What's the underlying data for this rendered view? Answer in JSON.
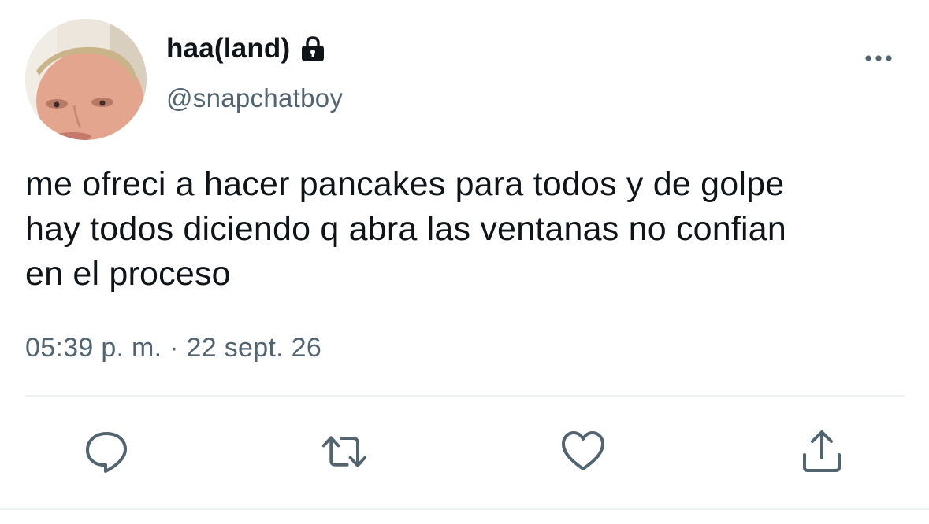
{
  "tweet": {
    "display_name": "haa(land)",
    "handle": "@snapchatboy",
    "text": "me ofreci a hacer pancakes para todos y de golpe\nhay todos diciendo q abra las ventanas no confian\nen el proceso",
    "time": "05:39 p. m.",
    "separator": "·",
    "date": "22 sept. 26"
  },
  "icons": {
    "lock": "lock-icon",
    "more": "more-horizontal-icon",
    "reply": "reply-icon",
    "retweet": "retweet-icon",
    "like": "heart-icon",
    "share": "share-icon"
  },
  "colors": {
    "text_primary": "#0f1419",
    "text_secondary": "#536471",
    "divider": "#eff3f4"
  }
}
